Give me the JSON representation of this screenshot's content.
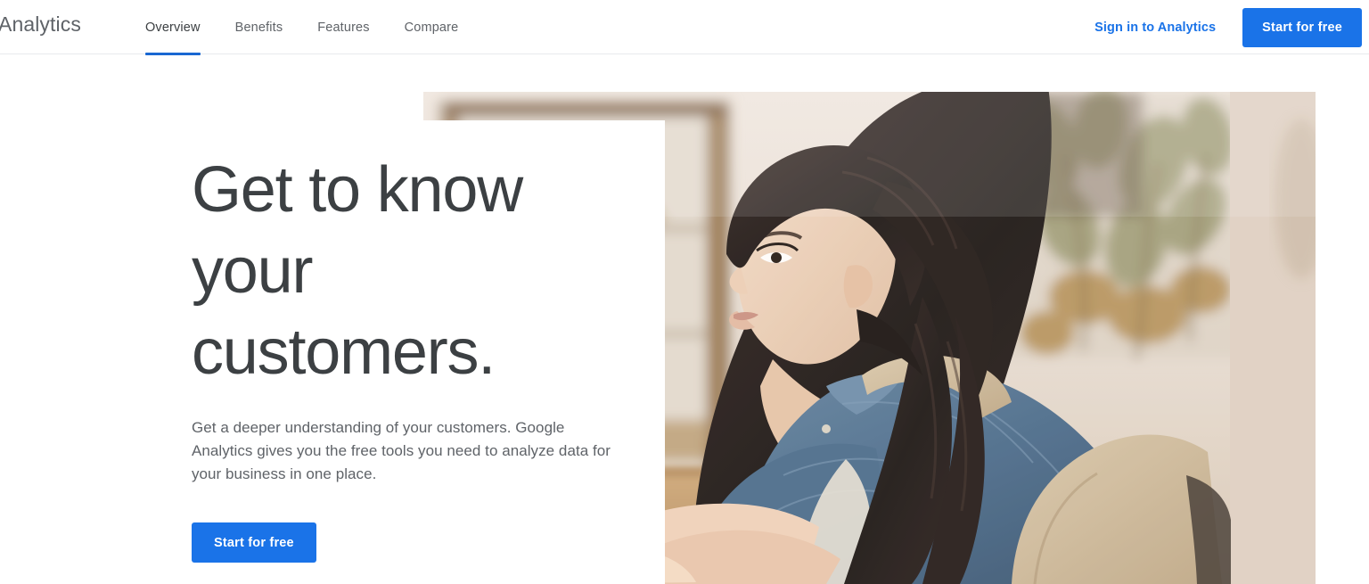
{
  "header": {
    "brand": "Analytics",
    "nav": [
      {
        "label": "Overview",
        "active": true
      },
      {
        "label": "Benefits",
        "active": false
      },
      {
        "label": "Features",
        "active": false
      },
      {
        "label": "Compare",
        "active": false
      }
    ],
    "signin_label": "Sign in to Analytics",
    "cta_label": "Start for free"
  },
  "hero": {
    "title_line1": "Get to know",
    "title_line2": "your",
    "title_line3": "customers.",
    "subtitle": "Get a deeper understanding of your customers. Google Analytics gives you the free tools you need to analyze data for your business in one place.",
    "cta_label": "Start for free",
    "photo_alt": "Woman in denim shirt and apron typing on a laptop in an artisan shop"
  },
  "colors": {
    "accent_blue": "#1a73e8",
    "active_underline": "#1967d2",
    "text_primary": "#3c4043",
    "text_secondary": "#5f6368",
    "border": "#e8eaed",
    "background": "#ffffff"
  }
}
